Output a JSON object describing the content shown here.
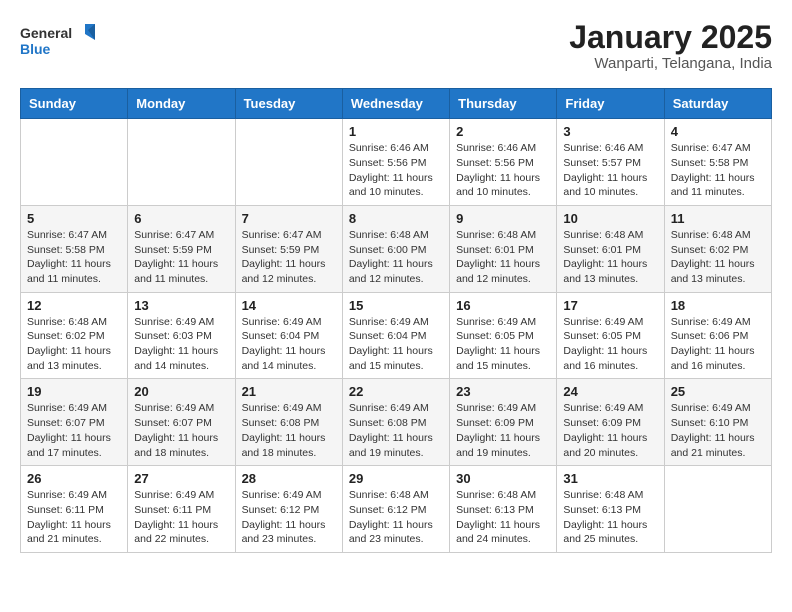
{
  "header": {
    "logo_line1": "General",
    "logo_line2": "Blue",
    "title": "January 2025",
    "subtitle": "Wanparti, Telangana, India"
  },
  "days_of_week": [
    "Sunday",
    "Monday",
    "Tuesday",
    "Wednesday",
    "Thursday",
    "Friday",
    "Saturday"
  ],
  "weeks": [
    [
      {
        "day": "",
        "info": ""
      },
      {
        "day": "",
        "info": ""
      },
      {
        "day": "",
        "info": ""
      },
      {
        "day": "1",
        "info": "Sunrise: 6:46 AM\nSunset: 5:56 PM\nDaylight: 11 hours and 10 minutes."
      },
      {
        "day": "2",
        "info": "Sunrise: 6:46 AM\nSunset: 5:56 PM\nDaylight: 11 hours and 10 minutes."
      },
      {
        "day": "3",
        "info": "Sunrise: 6:46 AM\nSunset: 5:57 PM\nDaylight: 11 hours and 10 minutes."
      },
      {
        "day": "4",
        "info": "Sunrise: 6:47 AM\nSunset: 5:58 PM\nDaylight: 11 hours and 11 minutes."
      }
    ],
    [
      {
        "day": "5",
        "info": "Sunrise: 6:47 AM\nSunset: 5:58 PM\nDaylight: 11 hours and 11 minutes."
      },
      {
        "day": "6",
        "info": "Sunrise: 6:47 AM\nSunset: 5:59 PM\nDaylight: 11 hours and 11 minutes."
      },
      {
        "day": "7",
        "info": "Sunrise: 6:47 AM\nSunset: 5:59 PM\nDaylight: 11 hours and 12 minutes."
      },
      {
        "day": "8",
        "info": "Sunrise: 6:48 AM\nSunset: 6:00 PM\nDaylight: 11 hours and 12 minutes."
      },
      {
        "day": "9",
        "info": "Sunrise: 6:48 AM\nSunset: 6:01 PM\nDaylight: 11 hours and 12 minutes."
      },
      {
        "day": "10",
        "info": "Sunrise: 6:48 AM\nSunset: 6:01 PM\nDaylight: 11 hours and 13 minutes."
      },
      {
        "day": "11",
        "info": "Sunrise: 6:48 AM\nSunset: 6:02 PM\nDaylight: 11 hours and 13 minutes."
      }
    ],
    [
      {
        "day": "12",
        "info": "Sunrise: 6:48 AM\nSunset: 6:02 PM\nDaylight: 11 hours and 13 minutes."
      },
      {
        "day": "13",
        "info": "Sunrise: 6:49 AM\nSunset: 6:03 PM\nDaylight: 11 hours and 14 minutes."
      },
      {
        "day": "14",
        "info": "Sunrise: 6:49 AM\nSunset: 6:04 PM\nDaylight: 11 hours and 14 minutes."
      },
      {
        "day": "15",
        "info": "Sunrise: 6:49 AM\nSunset: 6:04 PM\nDaylight: 11 hours and 15 minutes."
      },
      {
        "day": "16",
        "info": "Sunrise: 6:49 AM\nSunset: 6:05 PM\nDaylight: 11 hours and 15 minutes."
      },
      {
        "day": "17",
        "info": "Sunrise: 6:49 AM\nSunset: 6:05 PM\nDaylight: 11 hours and 16 minutes."
      },
      {
        "day": "18",
        "info": "Sunrise: 6:49 AM\nSunset: 6:06 PM\nDaylight: 11 hours and 16 minutes."
      }
    ],
    [
      {
        "day": "19",
        "info": "Sunrise: 6:49 AM\nSunset: 6:07 PM\nDaylight: 11 hours and 17 minutes."
      },
      {
        "day": "20",
        "info": "Sunrise: 6:49 AM\nSunset: 6:07 PM\nDaylight: 11 hours and 18 minutes."
      },
      {
        "day": "21",
        "info": "Sunrise: 6:49 AM\nSunset: 6:08 PM\nDaylight: 11 hours and 18 minutes."
      },
      {
        "day": "22",
        "info": "Sunrise: 6:49 AM\nSunset: 6:08 PM\nDaylight: 11 hours and 19 minutes."
      },
      {
        "day": "23",
        "info": "Sunrise: 6:49 AM\nSunset: 6:09 PM\nDaylight: 11 hours and 19 minutes."
      },
      {
        "day": "24",
        "info": "Sunrise: 6:49 AM\nSunset: 6:09 PM\nDaylight: 11 hours and 20 minutes."
      },
      {
        "day": "25",
        "info": "Sunrise: 6:49 AM\nSunset: 6:10 PM\nDaylight: 11 hours and 21 minutes."
      }
    ],
    [
      {
        "day": "26",
        "info": "Sunrise: 6:49 AM\nSunset: 6:11 PM\nDaylight: 11 hours and 21 minutes."
      },
      {
        "day": "27",
        "info": "Sunrise: 6:49 AM\nSunset: 6:11 PM\nDaylight: 11 hours and 22 minutes."
      },
      {
        "day": "28",
        "info": "Sunrise: 6:49 AM\nSunset: 6:12 PM\nDaylight: 11 hours and 23 minutes."
      },
      {
        "day": "29",
        "info": "Sunrise: 6:48 AM\nSunset: 6:12 PM\nDaylight: 11 hours and 23 minutes."
      },
      {
        "day": "30",
        "info": "Sunrise: 6:48 AM\nSunset: 6:13 PM\nDaylight: 11 hours and 24 minutes."
      },
      {
        "day": "31",
        "info": "Sunrise: 6:48 AM\nSunset: 6:13 PM\nDaylight: 11 hours and 25 minutes."
      },
      {
        "day": "",
        "info": ""
      }
    ]
  ]
}
